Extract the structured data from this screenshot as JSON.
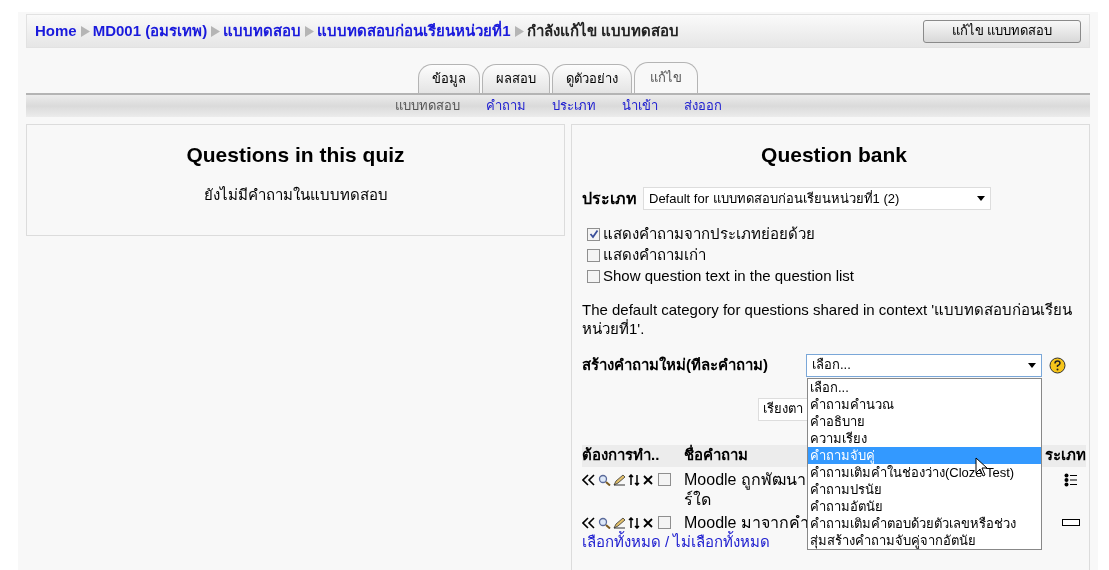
{
  "breadcrumb": {
    "links": [
      "Home",
      "MD001 (อมรเทพ)",
      "แบบทดสอบ",
      "แบบทดสอบก่อนเรียนหน่วยที่1"
    ],
    "current": "กำลังแก้ไข แบบทดสอบ"
  },
  "header_button": "แก้ไข แบบทดสอบ",
  "tabs": [
    {
      "label": "ข้อมูล",
      "selected": false
    },
    {
      "label": "ผลสอบ",
      "selected": false
    },
    {
      "label": "ดูตัวอย่าง",
      "selected": false
    },
    {
      "label": "แก้ไข",
      "selected": true
    }
  ],
  "subtabs": [
    {
      "label": "แบบทดสอบ",
      "selected": true
    },
    {
      "label": "คำถาม",
      "selected": false
    },
    {
      "label": "ประเภท",
      "selected": false
    },
    {
      "label": "นำเข้า",
      "selected": false
    },
    {
      "label": "ส่งออก",
      "selected": false
    }
  ],
  "quiz_panel": {
    "title": "Questions in this quiz",
    "message": "ยังไม่มีคำถามในแบบทดสอบ"
  },
  "bank_panel": {
    "title": "Question bank",
    "category_label": "ประเภท",
    "category_value": "Default for แบบทดสอบก่อนเรียนหน่วยที่1 (2)",
    "options": [
      {
        "label": "แสดงคำถามจากประเภทย่อยด้วย",
        "checked": true
      },
      {
        "label": "แสดงคำถามเก่า",
        "checked": false
      },
      {
        "label": "Show question text in the question list",
        "checked": false
      }
    ],
    "note": "The default category for questions shared in context 'แบบทดสอบก่อนเรียนหน่วยที่1'.",
    "create_label": "สร้างคำถามใหม่(ทีละคำถาม)",
    "create_value": "เลือก...",
    "create_menu": [
      {
        "label": "เลือก...",
        "selected": false
      },
      {
        "label": "คำถามคำนวณ",
        "selected": false
      },
      {
        "label": "คำอธิบาย",
        "selected": false
      },
      {
        "label": "ความเรียง",
        "selected": false
      },
      {
        "label": "คำถามจับคู่",
        "selected": true
      },
      {
        "label": "คำถามเติมคำในช่องว่าง(Cloze Test)",
        "selected": false
      },
      {
        "label": "คำถามปรนัย",
        "selected": false
      },
      {
        "label": "คำถามอัตนัย",
        "selected": false
      },
      {
        "label": "คำถามเติมคำตอบด้วยตัวเลขหรือช่วง",
        "selected": false
      },
      {
        "label": "สุ่มสร้างคำถามจับคู่จากอัตนัย",
        "selected": false
      }
    ],
    "sort_value": "เรียงตา",
    "columns": [
      "ต้องการทำ..",
      "ชื่อคำถาม",
      "ระเภท"
    ],
    "rows": [
      {
        "name_lines": [
          "Moodle ถูกพัฒนา",
          "ร์ใด"
        ],
        "checked": false,
        "kind": "multichoice"
      },
      {
        "name_lines": [
          "Moodle มาจากคำ"
        ],
        "checked": false,
        "kind": "shortanswer"
      }
    ],
    "select_links": [
      "เลือกทั้งหมด",
      "ไม่เลือกทั้งหมด"
    ],
    "select_separator": "/"
  }
}
